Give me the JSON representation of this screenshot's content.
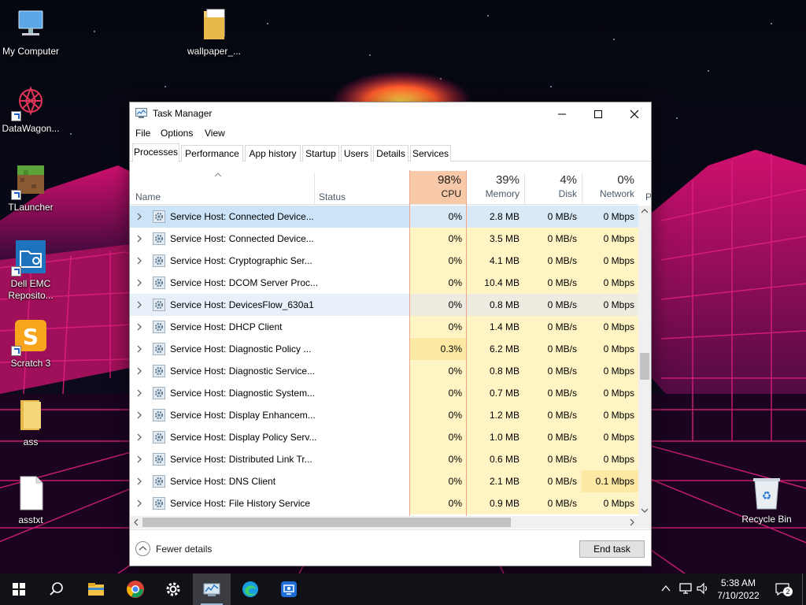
{
  "desktop": {
    "icons": [
      {
        "label": "My Computer"
      },
      {
        "label": "wallpaper_..."
      },
      {
        "label": "DataWagon..."
      },
      {
        "label": "TLauncher"
      },
      {
        "label": "Dell EMC Reposito..."
      },
      {
        "label": "Scratch 3"
      },
      {
        "label": "ass"
      },
      {
        "label": "asstxt"
      },
      {
        "label": "Recycle Bin"
      }
    ]
  },
  "task_manager": {
    "title": "Task Manager",
    "menu": [
      "File",
      "Options",
      "View"
    ],
    "tabs": [
      "Processes",
      "Performance",
      "App history",
      "Startup",
      "Users",
      "Details",
      "Services"
    ],
    "active_tab": "Processes",
    "columns": {
      "name": "Name",
      "status": "Status",
      "cpu": {
        "pct": "98%",
        "label": "CPU"
      },
      "memory": {
        "pct": "39%",
        "label": "Memory"
      },
      "disk": {
        "pct": "4%",
        "label": "Disk"
      },
      "network": {
        "pct": "0%",
        "label": "Network"
      },
      "power_partial": "P"
    },
    "rows": [
      {
        "name": "Service Host: Connected Device...",
        "cpu": "0%",
        "memory": "2.8 MB",
        "disk": "0 MB/s",
        "network": "0 Mbps",
        "state": "selected"
      },
      {
        "name": "Service Host: Connected Device...",
        "cpu": "0%",
        "memory": "3.5 MB",
        "disk": "0 MB/s",
        "network": "0 Mbps",
        "state": ""
      },
      {
        "name": "Service Host: Cryptographic Ser...",
        "cpu": "0%",
        "memory": "4.1 MB",
        "disk": "0 MB/s",
        "network": "0 Mbps",
        "state": ""
      },
      {
        "name": "Service Host: DCOM Server Proc...",
        "cpu": "0%",
        "memory": "10.4 MB",
        "disk": "0 MB/s",
        "network": "0 Mbps",
        "state": ""
      },
      {
        "name": "Service Host: DevicesFlow_630a1",
        "cpu": "0%",
        "memory": "0.8 MB",
        "disk": "0 MB/s",
        "network": "0 Mbps",
        "state": "hover"
      },
      {
        "name": "Service Host: DHCP Client",
        "cpu": "0%",
        "memory": "1.4 MB",
        "disk": "0 MB/s",
        "network": "0 Mbps",
        "state": ""
      },
      {
        "name": "Service Host: Diagnostic Policy ...",
        "cpu": "0.3%",
        "memory": "6.2 MB",
        "disk": "0 MB/s",
        "network": "0 Mbps",
        "state": "",
        "cpu_hi": true
      },
      {
        "name": "Service Host: Diagnostic Service...",
        "cpu": "0%",
        "memory": "0.8 MB",
        "disk": "0 MB/s",
        "network": "0 Mbps",
        "state": ""
      },
      {
        "name": "Service Host: Diagnostic System...",
        "cpu": "0%",
        "memory": "0.7 MB",
        "disk": "0 MB/s",
        "network": "0 Mbps",
        "state": ""
      },
      {
        "name": "Service Host: Display Enhancem...",
        "cpu": "0%",
        "memory": "1.2 MB",
        "disk": "0 MB/s",
        "network": "0 Mbps",
        "state": ""
      },
      {
        "name": "Service Host: Display Policy Serv...",
        "cpu": "0%",
        "memory": "1.0 MB",
        "disk": "0 MB/s",
        "network": "0 Mbps",
        "state": ""
      },
      {
        "name": "Service Host: Distributed Link Tr...",
        "cpu": "0%",
        "memory": "0.6 MB",
        "disk": "0 MB/s",
        "network": "0 Mbps",
        "state": ""
      },
      {
        "name": "Service Host: DNS Client",
        "cpu": "0%",
        "memory": "2.1 MB",
        "disk": "0 MB/s",
        "network": "0.1 Mbps",
        "state": "",
        "net_hi": true
      },
      {
        "name": "Service Host: File History Service",
        "cpu": "0%",
        "memory": "0.9 MB",
        "disk": "0 MB/s",
        "network": "0 Mbps",
        "state": ""
      }
    ],
    "footer": {
      "fewer_details": "Fewer details",
      "end_task": "End task"
    }
  },
  "taskbar": {
    "pinned": [
      "start-icon",
      "search-icon",
      "file-explorer-icon",
      "chrome-icon",
      "settings-icon",
      "task-manager-icon",
      "edge-icon",
      "remote-desktop-icon"
    ],
    "clock": {
      "time": "5:38 AM",
      "date": "7/10/2022"
    },
    "notification_count": "2"
  }
}
